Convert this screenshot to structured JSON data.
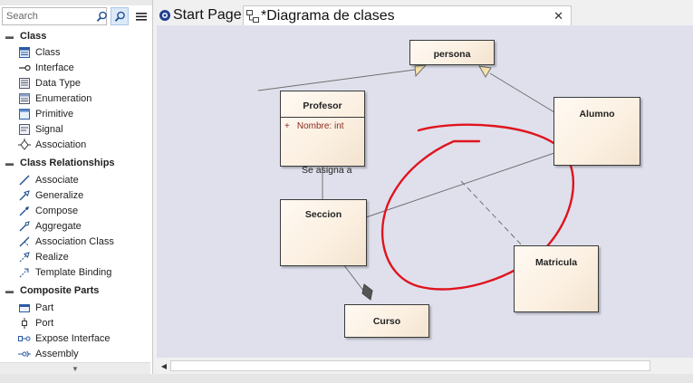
{
  "toolbox": {
    "search_placeholder": "Search",
    "groups": [
      {
        "title": "Class",
        "items": [
          {
            "label": "Class",
            "icon": "class-icon"
          },
          {
            "label": "Interface",
            "icon": "interface-icon"
          },
          {
            "label": "Data Type",
            "icon": "data-type-icon"
          },
          {
            "label": "Enumeration",
            "icon": "enumeration-icon"
          },
          {
            "label": "Primitive",
            "icon": "primitive-icon"
          },
          {
            "label": "Signal",
            "icon": "signal-icon"
          },
          {
            "label": "Association",
            "icon": "association-icon"
          }
        ]
      },
      {
        "title": "Class Relationships",
        "items": [
          {
            "label": "Associate",
            "icon": "associate-icon"
          },
          {
            "label": "Generalize",
            "icon": "generalize-icon"
          },
          {
            "label": "Compose",
            "icon": "compose-icon"
          },
          {
            "label": "Aggregate",
            "icon": "aggregate-icon"
          },
          {
            "label": "Association Class",
            "icon": "association-class-icon"
          },
          {
            "label": "Realize",
            "icon": "realize-icon"
          },
          {
            "label": "Template Binding",
            "icon": "template-binding-icon"
          }
        ]
      },
      {
        "title": "Composite Parts",
        "items": [
          {
            "label": "Part",
            "icon": "part-icon"
          },
          {
            "label": "Port",
            "icon": "port-icon"
          },
          {
            "label": "Expose Interface",
            "icon": "expose-interface-icon"
          },
          {
            "label": "Assembly",
            "icon": "assembly-icon"
          }
        ]
      }
    ]
  },
  "tabs": [
    {
      "label": "Start Page",
      "icon": "start-page-icon"
    },
    {
      "label": "*Diagrama de clases",
      "icon": "class-diagram-icon"
    }
  ],
  "diagram": {
    "classes": {
      "persona": {
        "name": "persona"
      },
      "profesor": {
        "name": "Profesor",
        "attributes": [
          {
            "visibility": "+",
            "text": "Nombre: int"
          }
        ]
      },
      "alumno": {
        "name": "Alumno"
      },
      "seccion": {
        "name": "Seccion"
      },
      "matricula": {
        "name": "Matricula"
      },
      "curso": {
        "name": "Curso"
      }
    },
    "association_label": "Se asigna a"
  },
  "colors": {
    "canvas_bg": "#dfe0ec",
    "class_fill": "#fbefe0",
    "annotation_red": "#e0141e",
    "attribute_text": "#8a2b1f",
    "generalization_arrow_fill": "#f6e2a8"
  }
}
